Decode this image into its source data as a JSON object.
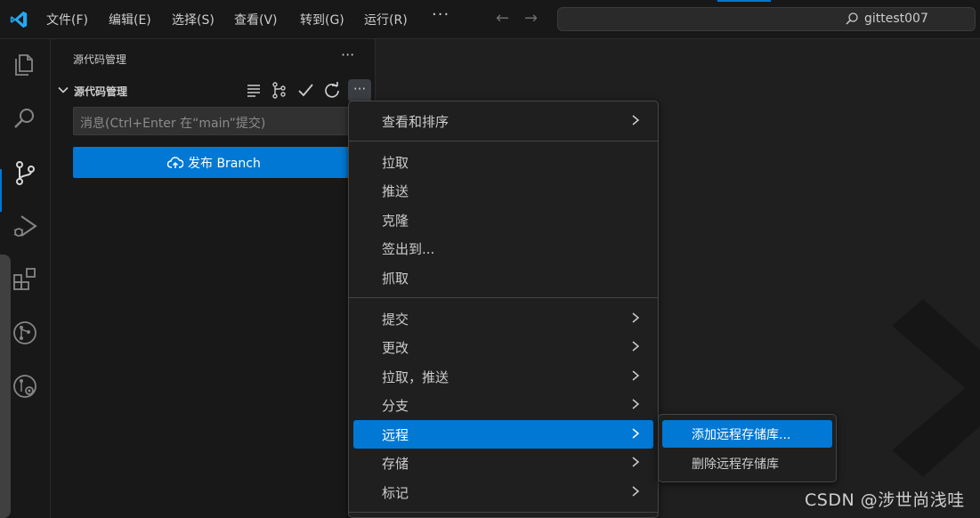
{
  "titlebar": {
    "menus": [
      "文件(F)",
      "编辑(E)",
      "选择(S)",
      "查看(V)",
      "转到(G)",
      "运行(R)"
    ],
    "more": "···",
    "search_text": "gittest007"
  },
  "activitybar": {
    "icons": [
      "explorer-icon",
      "search-icon",
      "source-control-icon",
      "run-debug-icon",
      "extensions-icon",
      "git-graph-icon",
      "remote-explorer-icon"
    ]
  },
  "sidebar": {
    "title": "源代码管理",
    "more": "···",
    "section_title": "源代码管理",
    "section_more": "···",
    "message_placeholder": "消息(Ctrl+Enter 在“main”提交)",
    "publish_label": "发布 Branch"
  },
  "context_menu": {
    "items": [
      {
        "label": "查看和排序",
        "submenu": true
      },
      {
        "label": "拉取",
        "submenu": false
      },
      {
        "label": "推送",
        "submenu": false
      },
      {
        "label": "克隆",
        "submenu": false
      },
      {
        "label": "签出到...",
        "submenu": false
      },
      {
        "label": "抓取",
        "submenu": false
      },
      {
        "label": "提交",
        "submenu": true
      },
      {
        "label": "更改",
        "submenu": true
      },
      {
        "label": "拉取，推送",
        "submenu": true
      },
      {
        "label": "分支",
        "submenu": true
      },
      {
        "label": "远程",
        "submenu": true,
        "active": true
      },
      {
        "label": "存储",
        "submenu": true
      },
      {
        "label": "标记",
        "submenu": true
      }
    ]
  },
  "submenu": {
    "items": [
      {
        "label": "添加远程存储库...",
        "active": true
      },
      {
        "label": "删除远程存储库",
        "active": false
      }
    ]
  },
  "colors": {
    "accent": "#0078d4",
    "background": "#1f1f1f",
    "panel": "#181818"
  },
  "watermark": "CSDN @涉世尚浅哇"
}
